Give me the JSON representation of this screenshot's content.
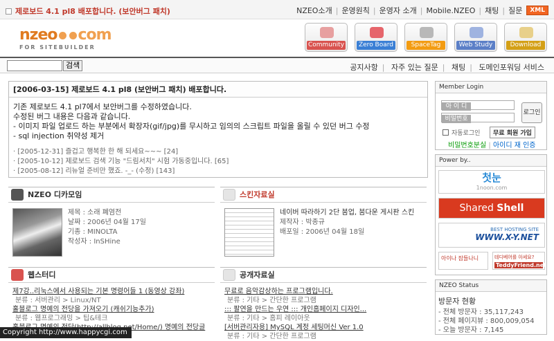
{
  "topbar": {
    "ticker": "제로보드 4.1 pl8 배포합니다. (보안버그 패치)",
    "nav": [
      "NZEO소개",
      "운영원칙",
      "운영자 소개",
      "Mobile.NZEO",
      "채팅",
      "질문"
    ],
    "xml_badge": "XML"
  },
  "logo": {
    "brand_left": "nzeo",
    "brand_right": "com",
    "tagline": "FOR SITEBUILDER"
  },
  "tiles": [
    {
      "label": "Community",
      "color": "#d9534f"
    },
    {
      "label": "Zero Board",
      "color": "#3a7fd5"
    },
    {
      "label": "SpaceTag",
      "color": "#f39c12"
    },
    {
      "label": "Web Study",
      "color": "#5b7fc7"
    },
    {
      "label": "Download",
      "color": "#d4a017"
    }
  ],
  "search": {
    "button": "검색",
    "value": ""
  },
  "quicklinks": [
    "공지사항",
    "자주 있는 질문",
    "채팅",
    "도메인포워딩 서비스"
  ],
  "notice": {
    "title": "[2006-03-15] 제로보드 4.1 pl8 (보안버그 패치) 배포합니다.",
    "body": [
      "기존 제로보드 4.1 pl7에서 보안버그를 수정하였습니다.",
      "수정된 버그 내용은 다음과 같습니다.",
      "- 이미지 파일 업로드 하는 부분에서 확장자(gif/jpg)를 무시하고 임의의 스크립트 파일을 올릴 수 있던 버그 수정",
      "- sql injection 취약성 제거"
    ],
    "recent": [
      "· [2005-12-31] 즐겁고 행복한 한 해 되세요~~~ [24]",
      "· [2005-10-12] 제로보드 검색 기능 \"드림서치\" 시험 가동중입니다. [65]",
      "· [2005-08-12] 리뉴얼 준비만 했죠. -_- (수정) [143]"
    ]
  },
  "camera": {
    "title": "NZEO 디카모임",
    "meta": [
      "제목 : 소래 폐염전",
      "날짜 : 2006년 04월 17일",
      "기종 : MINOLTA",
      "작성자 : InSHine"
    ]
  },
  "skin": {
    "title": "스킨자료실",
    "meta": [
      "네이버 따라하기 2단 붐업, 붐다운 게시판 스킨",
      "제작자 : 박종규",
      "배포일 : 2006년 04월 18일"
    ]
  },
  "webstudy": {
    "title": "웹스터디",
    "posts": [
      {
        "title": "제7강..리눅스에서 사용되는 기본 명령어들 1 (동영상 강좌)",
        "cat": "분류 : 서버관리 > Linux/NT"
      },
      {
        "title": "홀블로그 명예의 전당을 가져오기 (캐쉬기능추가)",
        "cat": "분류 : 웹프로그래밍 > 팁&테크"
      },
      {
        "title": "홀블로그 명예의 전당(http://allblog.net/Home/) 명예의 전당글",
        "cat": ""
      }
    ]
  },
  "pds": {
    "title": "공개자료실",
    "posts": [
      {
        "title": "무료로 음악감상하는 프로그램입니다.",
        "cat": "분류 : 기타 > 간단한 프로그램"
      },
      {
        "title": "::: 팔연을 만드는 우연 ::: 개인홈페이지 디자인...",
        "cat": "분류 : 기타 > 홈피 레이아웃"
      },
      {
        "title": "[서버관리자용] MySQL 계정 세팅머신 Ver 1.0",
        "cat": "분류 : 기타 > 간단한 프로그램"
      }
    ]
  },
  "login": {
    "title": "Member Login",
    "id_label": "아 이 디",
    "pw_label": "비밀번호",
    "button": "로그인",
    "autologin": "자동로그인",
    "join": "무료 회원 가입",
    "find_pw": "비밀번호분실",
    "find_id": "아이디 재 인증"
  },
  "powerby": {
    "title": "Power by..",
    "banner1_main": "첫눈",
    "banner1_sub": "1noon.com",
    "banner2_left": "Shared",
    "banner2_right": "Shell",
    "banner3_top": "BEST HOSTING SITE",
    "banner3_main": "WWW.X-Y.NET",
    "banner4a": "아이나 잠들나니",
    "banner4b_top": "테디베어를 아세요?",
    "banner4b_main": "TeddyFriend.net"
  },
  "stats": {
    "title": "NZEO Status",
    "heading": "방문자 현황",
    "rows": [
      "- 전체 방문자 : 35,117,243",
      "- 전체 페이지뷰 : 800,009,054",
      "- 오늘 방문자 : 7,145"
    ]
  },
  "copyright": "Copyright   http://www.happycgi.com"
}
